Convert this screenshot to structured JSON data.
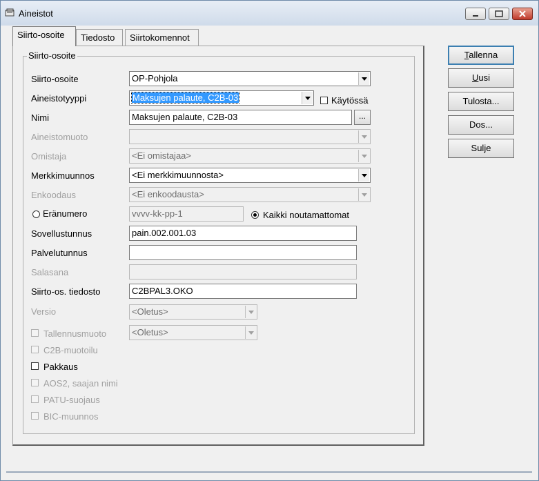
{
  "window": {
    "title": "Aineistot"
  },
  "tabs": [
    "Siirto-osoite",
    "Tiedosto",
    "Siirtokomennot"
  ],
  "group_title": "Siirto-osoite",
  "form": {
    "siirto_osoite": {
      "label": "Siirto-osoite",
      "value": "OP-Pohjola"
    },
    "aineistotyyppi": {
      "label": "Aineistotyyppi",
      "value": "Maksujen palaute, C2B-03"
    },
    "kaytossa": {
      "label": "Käytössä",
      "checked": false
    },
    "nimi": {
      "label": "Nimi",
      "value": "Maksujen palaute, C2B-03",
      "browse": "..."
    },
    "aineistomuoto": {
      "label": "Aineistomuoto",
      "value": ""
    },
    "omistaja": {
      "label": "Omistaja",
      "value": "<Ei omistajaa>"
    },
    "merkkimuunnos": {
      "label": "Merkkimuunnos",
      "value": "<Ei merkkimuunnosta>"
    },
    "enkoodaus": {
      "label": "Enkoodaus",
      "value": "<Ei enkoodausta>"
    },
    "eranumero": {
      "label": "Eränumero",
      "value": "vvvv-kk-pp-1",
      "selected": false
    },
    "kaikki": {
      "label": "Kaikki noutamattomat",
      "selected": true
    },
    "sovellustunnus": {
      "label": "Sovellustunnus",
      "value": "pain.002.001.03"
    },
    "palvelutunnus": {
      "label": "Palvelutunnus",
      "value": ""
    },
    "salasana": {
      "label": "Salasana",
      "value": ""
    },
    "siirto_os_tiedosto": {
      "label": "Siirto-os. tiedosto",
      "value": "C2BPAL3.OKO"
    },
    "versio": {
      "label": "Versio",
      "value": "<Oletus>"
    },
    "tallennusmuoto": {
      "label": "Tallennusmuoto",
      "value": "<Oletus>"
    },
    "c2b_muotoilu": {
      "label": "C2B-muotoilu"
    },
    "pakkaus": {
      "label": "Pakkaus"
    },
    "aos2": {
      "label": "AOS2, saajan nimi"
    },
    "patu": {
      "label": "PATU-suojaus"
    },
    "bic": {
      "label": "BIC-muunnos"
    }
  },
  "buttons": {
    "tallenna": {
      "first": "T",
      "rest": "allenna"
    },
    "uusi": {
      "first": "U",
      "rest": "usi"
    },
    "tulosta": "Tulosta...",
    "dos": "Dos...",
    "sulje": "Sulje"
  }
}
